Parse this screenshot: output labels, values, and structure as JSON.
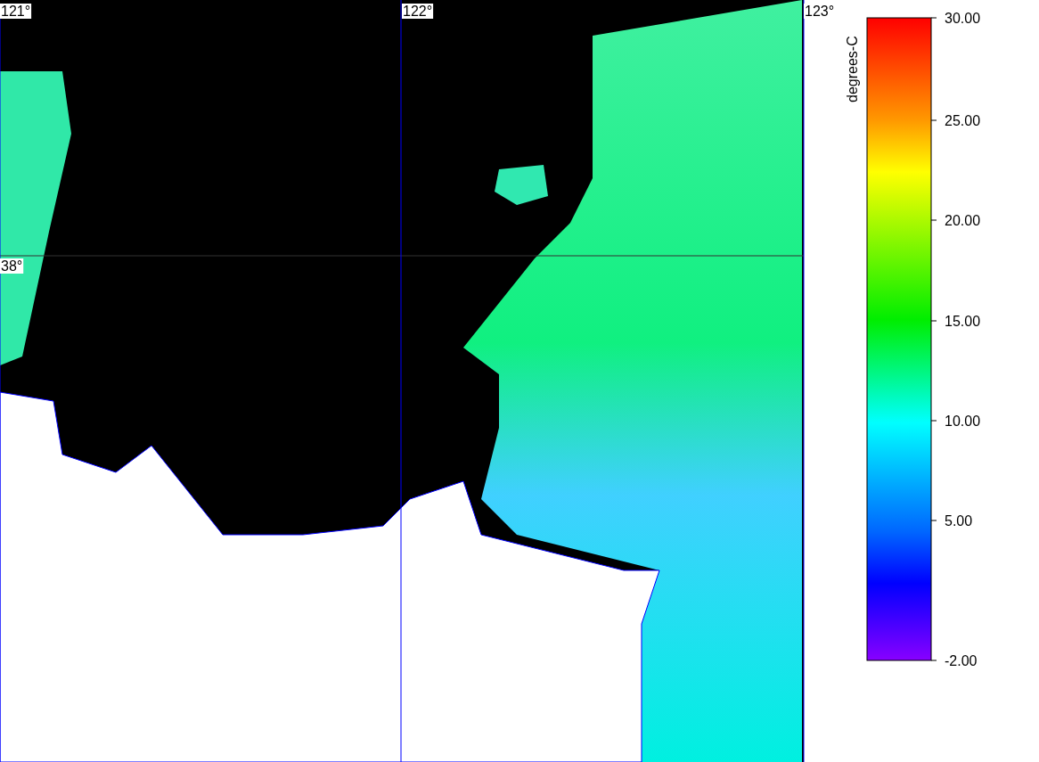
{
  "map": {
    "longitude_labels": [
      "121°",
      "122°",
      "123°"
    ],
    "latitude_labels": [
      "38°"
    ]
  },
  "color_scale": {
    "unit": "degrees-C",
    "ticks": [
      "30.00",
      "25.00",
      "20.00",
      "15.00",
      "10.00",
      "5.00",
      "-2.00"
    ]
  }
}
